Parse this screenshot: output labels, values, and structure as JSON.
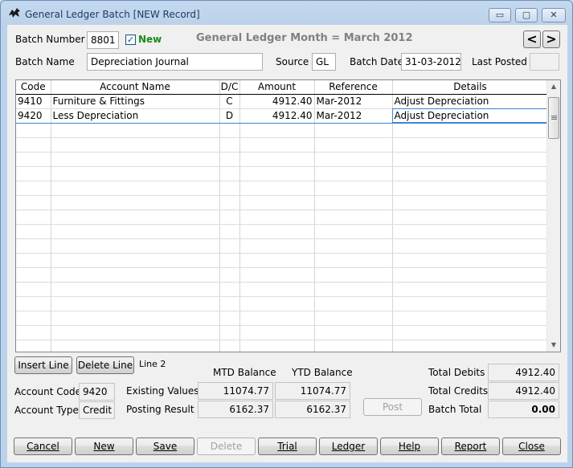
{
  "window": {
    "title": "General Ledger Batch [NEW Record]",
    "controls": {
      "minimize": "▭",
      "maximize": "▢",
      "close": "✕"
    }
  },
  "header": {
    "batch_number_label": "Batch Number",
    "batch_number": "8801",
    "new_checked": "✓",
    "new_label": "New",
    "month_heading": "General Ledger Month = March 2012",
    "prev": "<",
    "next": ">",
    "batch_name_label": "Batch Name",
    "batch_name": "Depreciation Journal",
    "source_label": "Source",
    "source": "GL",
    "batch_date_label": "Batch Date",
    "batch_date": "31-03-2012",
    "last_posted_label": "Last Posted",
    "last_posted": ""
  },
  "grid": {
    "columns": [
      "Code",
      "Account Name",
      "D/C",
      "Amount",
      "Reference",
      "Details"
    ],
    "rows": [
      [
        "9410",
        "Furniture & Fittings",
        "C",
        "4912.40",
        "Mar-2012",
        "Adjust Depreciation"
      ],
      [
        "9420",
        "Less Depreciation",
        "D",
        "4912.40",
        "Mar-2012",
        "Adjust Depreciation"
      ]
    ],
    "scroll_up": "▲",
    "scroll_down": "▼"
  },
  "line_controls": {
    "insert_line": "Insert Line",
    "delete_line": "Delete Line",
    "line_indicator": "Line 2"
  },
  "account": {
    "code_label": "Account Code",
    "code": "9420",
    "type_label": "Account Type",
    "type": "Credit"
  },
  "balances": {
    "mtd_label": "MTD Balance",
    "ytd_label": "YTD Balance",
    "existing_label": "Existing Values",
    "existing_mtd": "11074.77",
    "existing_ytd": "11074.77",
    "result_label": "Posting Result",
    "result_mtd": "6162.37",
    "result_ytd": "6162.37",
    "post_button": "Post"
  },
  "totals": {
    "debits_label": "Total Debits",
    "debits": "4912.40",
    "credits_label": "Total Credits",
    "credits": "4912.40",
    "batch_total_label": "Batch Total",
    "batch_total": "0.00"
  },
  "actions": {
    "cancel": "Cancel",
    "new": "New",
    "save": "Save",
    "delete": "Delete",
    "trial": "Trial",
    "ledger": "Ledger",
    "help": "Help",
    "report": "Report",
    "close": "Close"
  }
}
